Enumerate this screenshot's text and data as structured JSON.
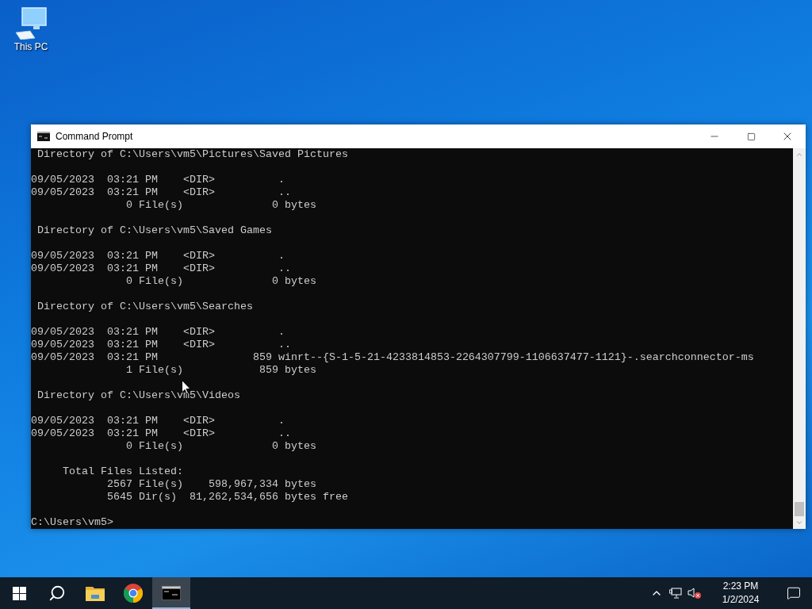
{
  "desktop_icons": [
    {
      "label": "This PC"
    }
  ],
  "window": {
    "title": "Command Prompt"
  },
  "console": {
    "blocks": [
      [
        " Directory of C:\\Users\\vm5\\Pictures\\Saved Pictures"
      ],
      [
        "09/05/2023  03:21 PM    <DIR>          .",
        "09/05/2023  03:21 PM    <DIR>          ..",
        "               0 File(s)              0 bytes"
      ],
      [
        " Directory of C:\\Users\\vm5\\Saved Games"
      ],
      [
        "09/05/2023  03:21 PM    <DIR>          .",
        "09/05/2023  03:21 PM    <DIR>          ..",
        "               0 File(s)              0 bytes"
      ],
      [
        " Directory of C:\\Users\\vm5\\Searches"
      ],
      [
        "09/05/2023  03:21 PM    <DIR>          .",
        "09/05/2023  03:21 PM    <DIR>          ..",
        "09/05/2023  03:21 PM               859 winrt--{S-1-5-21-4233814853-2264307799-1106637477-1121}-.searchconnector-ms",
        "               1 File(s)            859 bytes"
      ],
      [
        " Directory of C:\\Users\\vm5\\Videos"
      ],
      [
        "09/05/2023  03:21 PM    <DIR>          .",
        "09/05/2023  03:21 PM    <DIR>          ..",
        "               0 File(s)              0 bytes"
      ],
      [
        "     Total Files Listed:",
        "            2567 File(s)    598,967,334 bytes",
        "            5645 Dir(s)  81,262,534,656 bytes free"
      ],
      [
        "C:\\Users\\vm5>"
      ]
    ]
  },
  "taskbar": {
    "apps": [
      {
        "kind": "start",
        "selected": false
      },
      {
        "kind": "search",
        "selected": false
      },
      {
        "kind": "explorer",
        "selected": false
      },
      {
        "kind": "chrome",
        "selected": false
      },
      {
        "kind": "terminal",
        "selected": true
      }
    ],
    "time": "2:23 PM",
    "date": "1/2/2024"
  }
}
